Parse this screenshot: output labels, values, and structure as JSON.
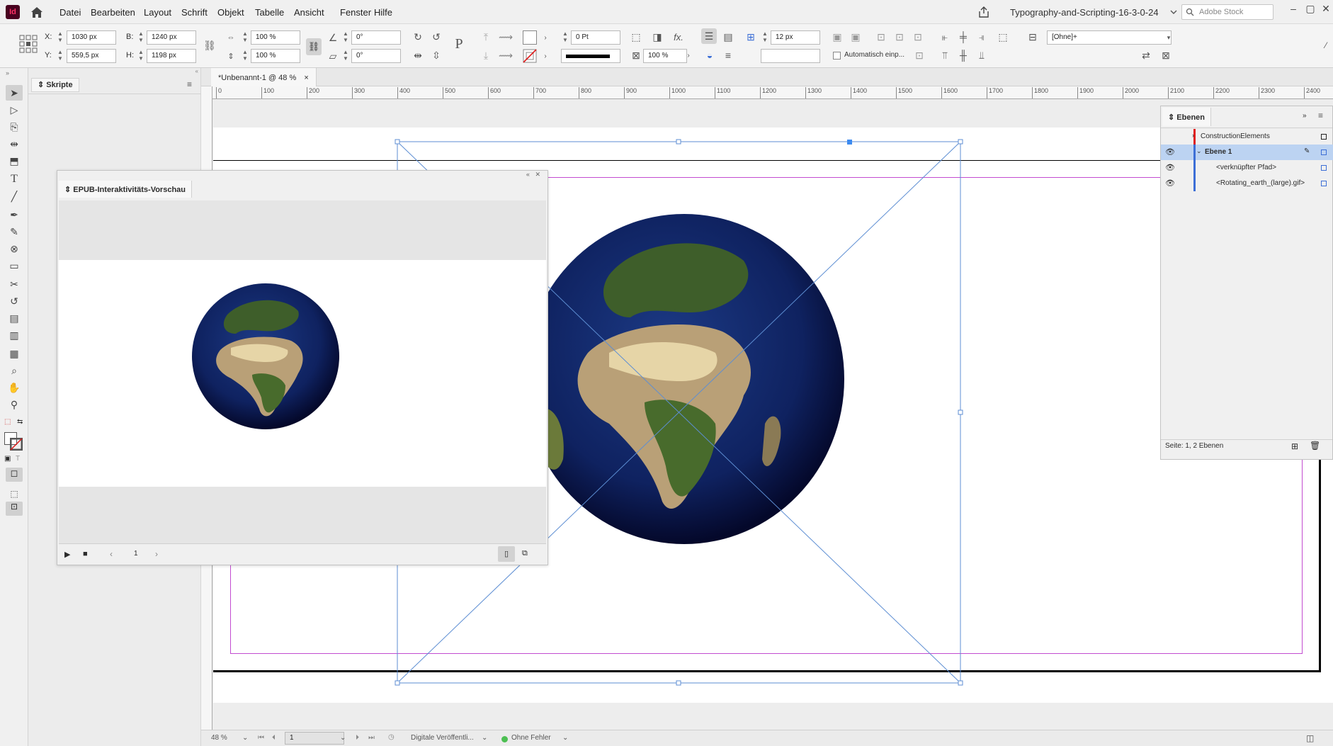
{
  "app": {
    "icon_text": "Id",
    "doc_title": "Typography-and-Scripting-16-3-0-24",
    "stock_placeholder": "Adobe Stock"
  },
  "menu": [
    "Datei",
    "Bearbeiten",
    "Layout",
    "Schrift",
    "Objekt",
    "Tabelle",
    "Ansicht",
    "Fenster",
    "Hilfe"
  ],
  "control": {
    "x_label": "X:",
    "x_value": "1030 px",
    "y_label": "Y:",
    "y_value": "559,5 px",
    "b_label": "B:",
    "b_value": "1240 px",
    "h_label": "H:",
    "h_value": "1198 px",
    "scale_x": "100 %",
    "scale_y": "100 %",
    "rotate": "0°",
    "shear": "0°",
    "stroke_weight": "0 Pt",
    "opacity": "100 %",
    "gap": "12 px",
    "auto_fit": "Automatisch einp...",
    "object_style": "[Ohne]+"
  },
  "scripts_panel": {
    "title": "Skripte"
  },
  "doc_tab": {
    "label": "*Unbenannt-1 @ 48 %",
    "close": "×"
  },
  "ruler_labels": [
    "0",
    "100",
    "200",
    "300",
    "400",
    "500",
    "600",
    "700",
    "800",
    "900",
    "1000",
    "1100",
    "1200",
    "1300",
    "1400",
    "1500",
    "1600",
    "1700",
    "1800",
    "1900",
    "2000",
    "2100",
    "2200",
    "2300",
    "2400"
  ],
  "epub_panel": {
    "title": "EPUB-Interaktivitäts-Vorschau",
    "page": "1"
  },
  "layers_panel": {
    "title": "Ebenen",
    "rows": [
      {
        "name": "ConstructionElements",
        "color": "#e01c1c"
      },
      {
        "name": "Ebene 1",
        "color": "#3d6fd6"
      },
      {
        "name": "<verknüpfter Pfad>",
        "color": "#3d6fd6"
      },
      {
        "name": "<Rotating_earth_(large).gif>",
        "color": "#3d6fd6"
      }
    ],
    "footer": "Seite: 1, 2 Ebenen"
  },
  "status": {
    "zoom": "48 %",
    "page": "1",
    "mode": "Digitale Veröffentli...",
    "errors": "Ohne Fehler"
  }
}
